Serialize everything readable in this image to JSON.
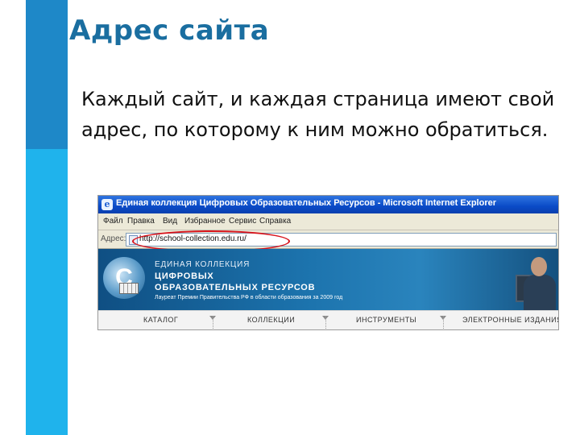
{
  "slide": {
    "title": "Адрес сайта",
    "body": "Каждый сайт, и каждая страница имеют свой адрес, по которому к ним можно обратиться."
  },
  "browser": {
    "window_title": "Единая коллекция Цифровых Образовательных Ресурсов - Microsoft Internet Explorer",
    "menu": [
      "Файл",
      "Правка",
      "Вид",
      "Избранное",
      "Сервис",
      "Справка"
    ],
    "address_label": "Адрес:",
    "url": "http://school-collection.edu.ru/",
    "highlight_color": "#d8131b"
  },
  "site": {
    "banner_line1": "ЕДИНАЯ КОЛЛЕКЦИЯ",
    "banner_line2": "ЦИФРОВЫХ",
    "banner_line3": "ОБРАЗОВАТЕЛЬНЫХ РЕСУРСОВ",
    "banner_line4": "Лауреат Премии Правительства РФ в области образования за 2009 год",
    "nav": [
      "КАТАЛОГ",
      "КОЛЛЕКЦИИ",
      "ИНСТРУМЕНТЫ",
      "ЭЛЕКТРОННЫЕ ИЗДАНИЯ"
    ]
  },
  "colors": {
    "side_bar_dark": "#1e88c8",
    "side_bar_light": "#1fb3ec",
    "title_color": "#1a6ea0"
  },
  "icons": [
    "ie-icon",
    "page-icon",
    "collection-logo-icon",
    "books-icon",
    "person-photo",
    "nav-caret-icon"
  ]
}
